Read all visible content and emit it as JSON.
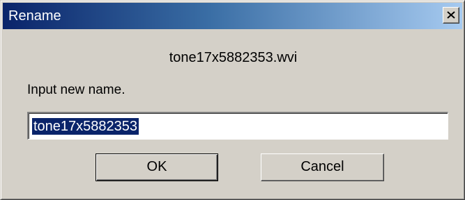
{
  "window": {
    "title": "Rename",
    "close_icon": "close-icon"
  },
  "dialog": {
    "filename": "tone17x5882353.wvi",
    "prompt": "Input new name.",
    "input_value": "tone17x5882353"
  },
  "buttons": {
    "ok_label": "OK",
    "cancel_label": "Cancel"
  },
  "colors": {
    "titlebar_start": "#0a246a",
    "titlebar_end": "#a6caf0",
    "dialog_bg": "#d4d0c8",
    "selection_bg": "#0a246a"
  }
}
